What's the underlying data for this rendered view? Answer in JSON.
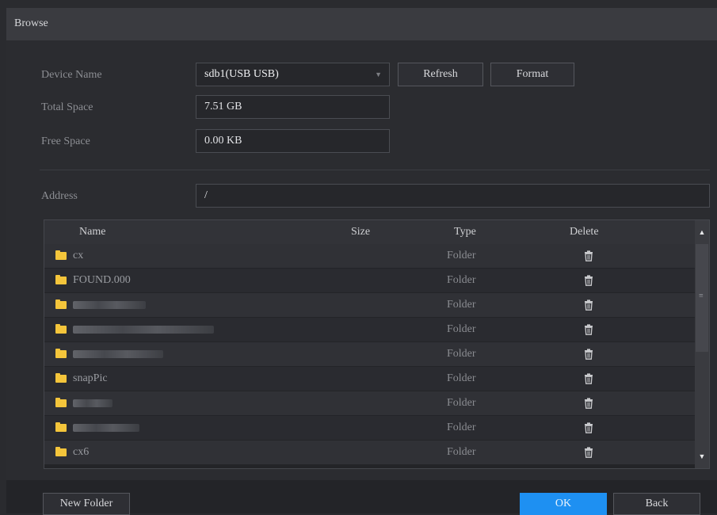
{
  "window": {
    "title": "Browse"
  },
  "device": {
    "name_label": "Device Name",
    "name_value": "sdb1(USB USB)",
    "refresh_label": "Refresh",
    "format_label": "Format",
    "total_label": "Total Space",
    "total_value": "7.51 GB",
    "free_label": "Free Space",
    "free_value": "0.00 KB"
  },
  "address": {
    "label": "Address",
    "value": "/"
  },
  "table": {
    "columns": {
      "name": "Name",
      "size": "Size",
      "type": "Type",
      "delete": "Delete"
    },
    "rows": [
      {
        "name": "cx",
        "size": "",
        "type": "Folder"
      },
      {
        "name": "FOUND.000",
        "size": "",
        "type": "Folder"
      },
      {
        "name": "",
        "size": "",
        "type": "Folder"
      },
      {
        "name": "",
        "size": "",
        "type": "Folder"
      },
      {
        "name": "",
        "size": "",
        "type": "Folder"
      },
      {
        "name": "snapPic",
        "size": "",
        "type": "Folder"
      },
      {
        "name": "",
        "size": "",
        "type": "Folder"
      },
      {
        "name": "",
        "size": "",
        "type": "Folder"
      },
      {
        "name": "cx6",
        "size": "",
        "type": "Folder"
      }
    ]
  },
  "footer": {
    "new_folder_label": "New Folder",
    "ok_label": "OK",
    "back_label": "Back"
  },
  "icons": {
    "folder": "folder-icon",
    "delete": "trash-icon",
    "dropdown": "chevron-down-icon",
    "scroll_up": "arrow-up-icon",
    "scroll_down": "arrow-down-icon"
  },
  "colors": {
    "accent": "#1e90f2",
    "folder": "#f4c53b"
  }
}
